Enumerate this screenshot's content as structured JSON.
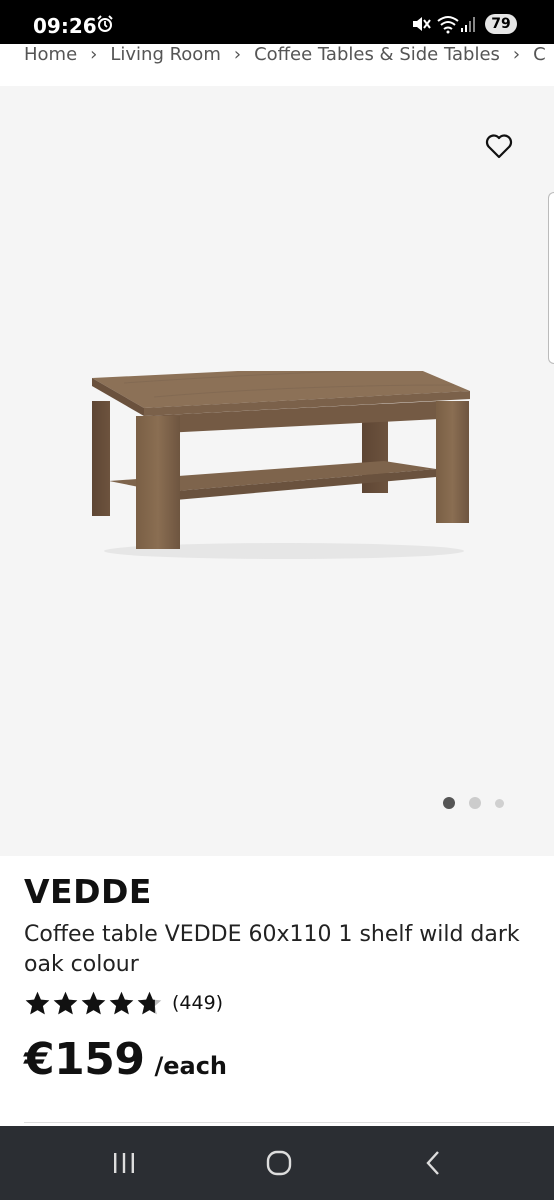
{
  "status_bar": {
    "time": "09:26",
    "battery": "79",
    "icons": [
      "alarm-icon",
      "mute-icon",
      "wifi-icon",
      "signal-icon"
    ]
  },
  "breadcrumb": {
    "items": [
      "Home",
      "Living Room",
      "Coffee Tables & Side Tables",
      "C"
    ],
    "separator": "›"
  },
  "gallery": {
    "image_count": 3,
    "active_index": 0,
    "favorite_icon": "heart-outline-icon",
    "background_color": "#f5f5f5"
  },
  "product": {
    "name": "VEDDE",
    "description": "Coffee table VEDDE 60x110 1 shelf wild dark oak colour",
    "rating": 4.7,
    "rating_max": 5,
    "review_count": "(449)",
    "price": "€159",
    "price_unit": "/each"
  },
  "nav_bar": {
    "buttons": [
      "recent-apps-icon",
      "home-icon",
      "back-icon"
    ]
  },
  "colors": {
    "text": "#111111",
    "nav_bar": "#2b2e33",
    "status_bar": "#000000",
    "dot_active": "#555555",
    "dot_inactive": "#cccccc"
  }
}
